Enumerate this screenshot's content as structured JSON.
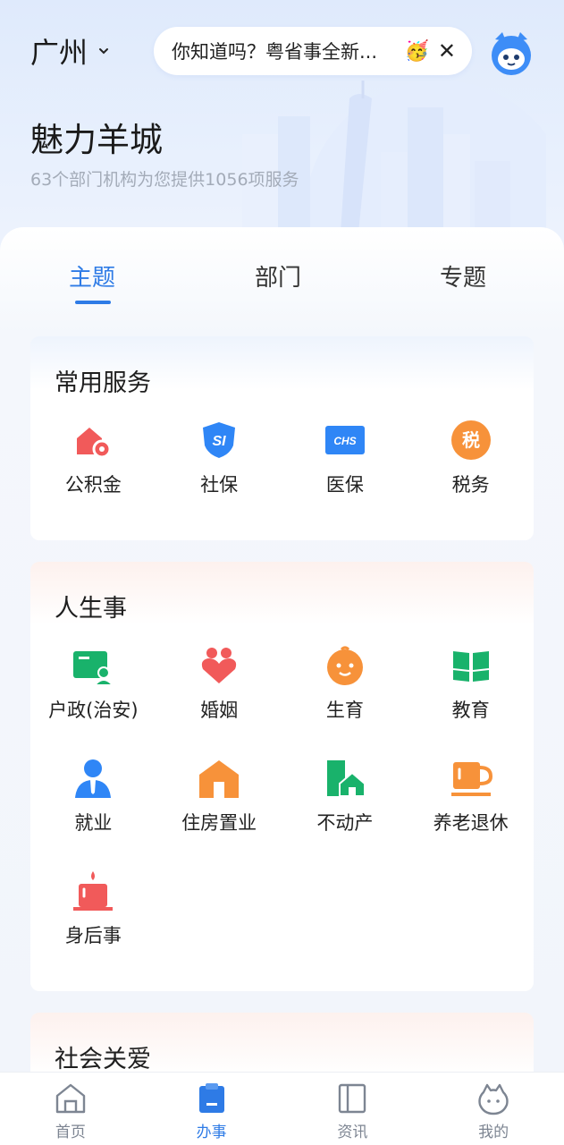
{
  "header": {
    "city": "广州",
    "tip_text": "你知道吗？粤省事全新...",
    "tip_emoji": "🥳",
    "tip_close": "✕",
    "title": "魅力羊城",
    "subtitle": "63个部门机构为您提供1056项服务"
  },
  "tabs": [
    {
      "label": "主题",
      "active": true
    },
    {
      "label": "部门",
      "active": false
    },
    {
      "label": "专题",
      "active": false
    }
  ],
  "sections": {
    "common": {
      "title": "常用服务",
      "items": [
        {
          "label": "公积金",
          "icon": "housing-fund-icon"
        },
        {
          "label": "社保",
          "icon": "social-security-icon"
        },
        {
          "label": "医保",
          "icon": "medical-insurance-icon"
        },
        {
          "label": "税务",
          "icon": "tax-icon"
        }
      ]
    },
    "life": {
      "title": "人生事",
      "items": [
        {
          "label": "户政(治安)",
          "icon": "household-icon"
        },
        {
          "label": "婚姻",
          "icon": "marriage-icon"
        },
        {
          "label": "生育",
          "icon": "birth-icon"
        },
        {
          "label": "教育",
          "icon": "education-icon"
        },
        {
          "label": "就业",
          "icon": "employment-icon"
        },
        {
          "label": "住房置业",
          "icon": "house-icon"
        },
        {
          "label": "不动产",
          "icon": "real-estate-icon"
        },
        {
          "label": "养老退休",
          "icon": "retirement-icon"
        },
        {
          "label": "身后事",
          "icon": "funeral-icon"
        }
      ]
    },
    "social": {
      "title": "社会关爱"
    }
  },
  "tabbar": [
    {
      "label": "首页",
      "icon": "home-icon",
      "active": false
    },
    {
      "label": "办事",
      "icon": "service-icon",
      "active": true
    },
    {
      "label": "资讯",
      "icon": "news-icon",
      "active": false
    },
    {
      "label": "我的",
      "icon": "profile-icon",
      "active": false
    }
  ],
  "colors": {
    "accent": "#2e7be6",
    "red_icon": "#f15a5a",
    "blue_icon": "#2f86f6",
    "orange_icon": "#f7923a",
    "green_icon": "#19b26b"
  }
}
